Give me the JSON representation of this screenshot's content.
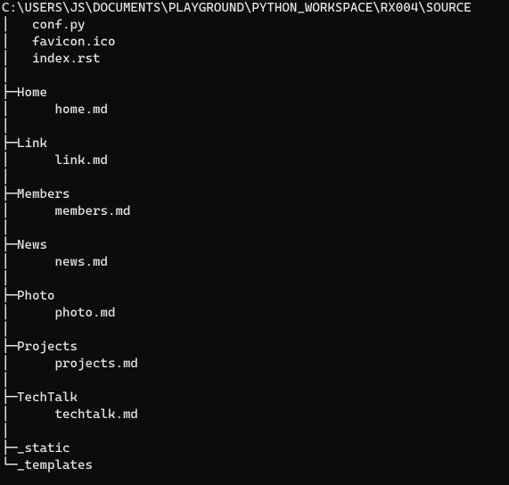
{
  "path": "C:\\USERS\\JS\\DOCUMENTS\\PLAYGROUND\\PYTHON_WORKSPACE\\RX004\\SOURCE",
  "tree_text": "│   conf.py\n│   favicon.ico\n│   index.rst\n│\n├─Home\n│      home.md\n│\n├─Link\n│      link.md\n│\n├─Members\n│      members.md\n│\n├─News\n│      news.md\n│\n├─Photo\n│      photo.md\n│\n├─Projects\n│      projects.md\n│\n├─TechTalk\n│      techtalk.md\n│\n├─_static\n└─_templates",
  "tree_data": {
    "root": "SOURCE",
    "files": [
      "conf.py",
      "favicon.ico",
      "index.rst"
    ],
    "dirs": [
      {
        "name": "Home",
        "files": [
          "home.md"
        ]
      },
      {
        "name": "Link",
        "files": [
          "link.md"
        ]
      },
      {
        "name": "Members",
        "files": [
          "members.md"
        ]
      },
      {
        "name": "News",
        "files": [
          "news.md"
        ]
      },
      {
        "name": "Photo",
        "files": [
          "photo.md"
        ]
      },
      {
        "name": "Projects",
        "files": [
          "projects.md"
        ]
      },
      {
        "name": "TechTalk",
        "files": [
          "techtalk.md"
        ]
      },
      {
        "name": "_static",
        "files": []
      },
      {
        "name": "_templates",
        "files": []
      }
    ]
  }
}
